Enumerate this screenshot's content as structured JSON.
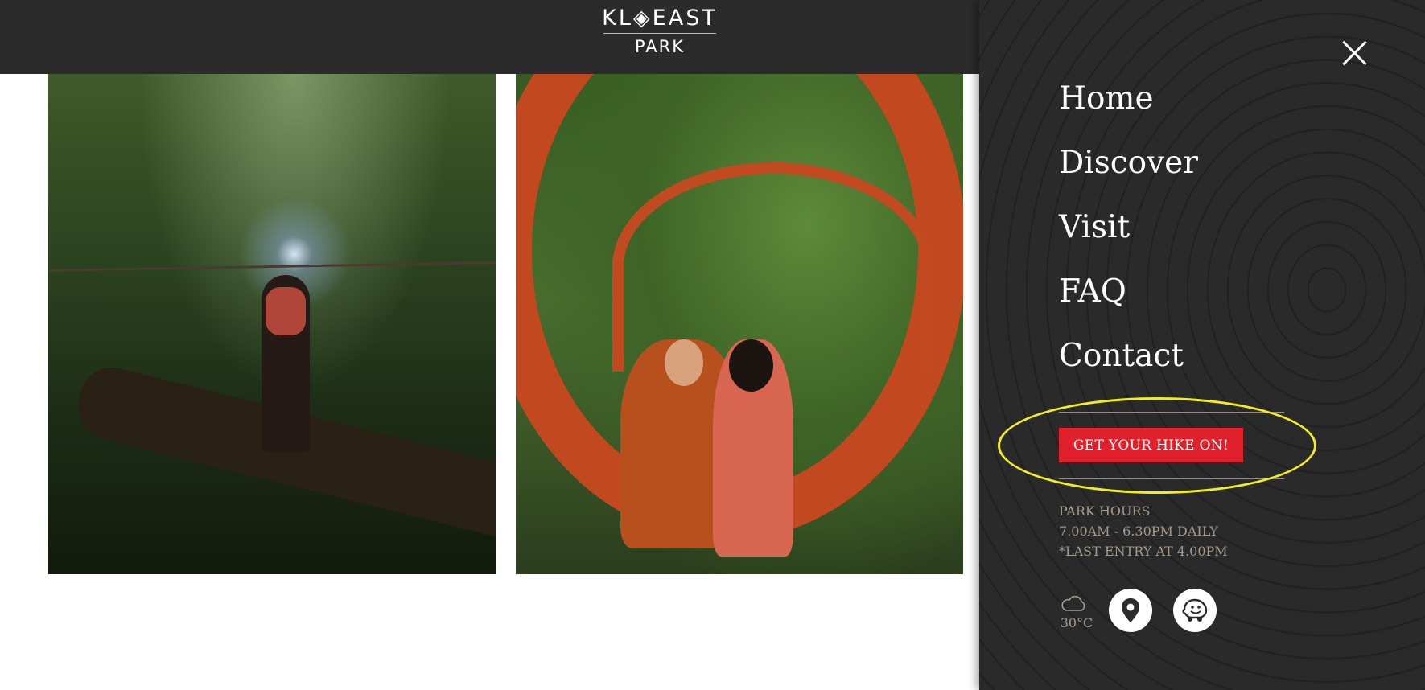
{
  "header": {
    "logo_top": "KL◈EAST",
    "logo_bottom": "PARK"
  },
  "menu": {
    "items": [
      {
        "label": "Home"
      },
      {
        "label": "Discover"
      },
      {
        "label": "Visit"
      },
      {
        "label": "FAQ"
      },
      {
        "label": "Contact"
      }
    ],
    "cta_label": "GET YOUR HIKE ON!",
    "hours": {
      "title": "PARK HOURS",
      "daily": "7.00AM - 6.30PM DAILY",
      "last_entry": "*LAST ENTRY AT 4.00PM"
    },
    "weather": {
      "icon": "cloud-icon",
      "temperature": "30°C"
    },
    "icons": {
      "close": "close-icon",
      "location": "map-pin-icon",
      "waze": "waze-icon"
    }
  },
  "colors": {
    "header_bg": "#2b2b2b",
    "panel_bg": "#2a2a2a",
    "cta_bg": "#e0202a",
    "highlight": "#f2ee1e",
    "muted_text": "#a59a8d",
    "nav_text": "#ffffff"
  }
}
